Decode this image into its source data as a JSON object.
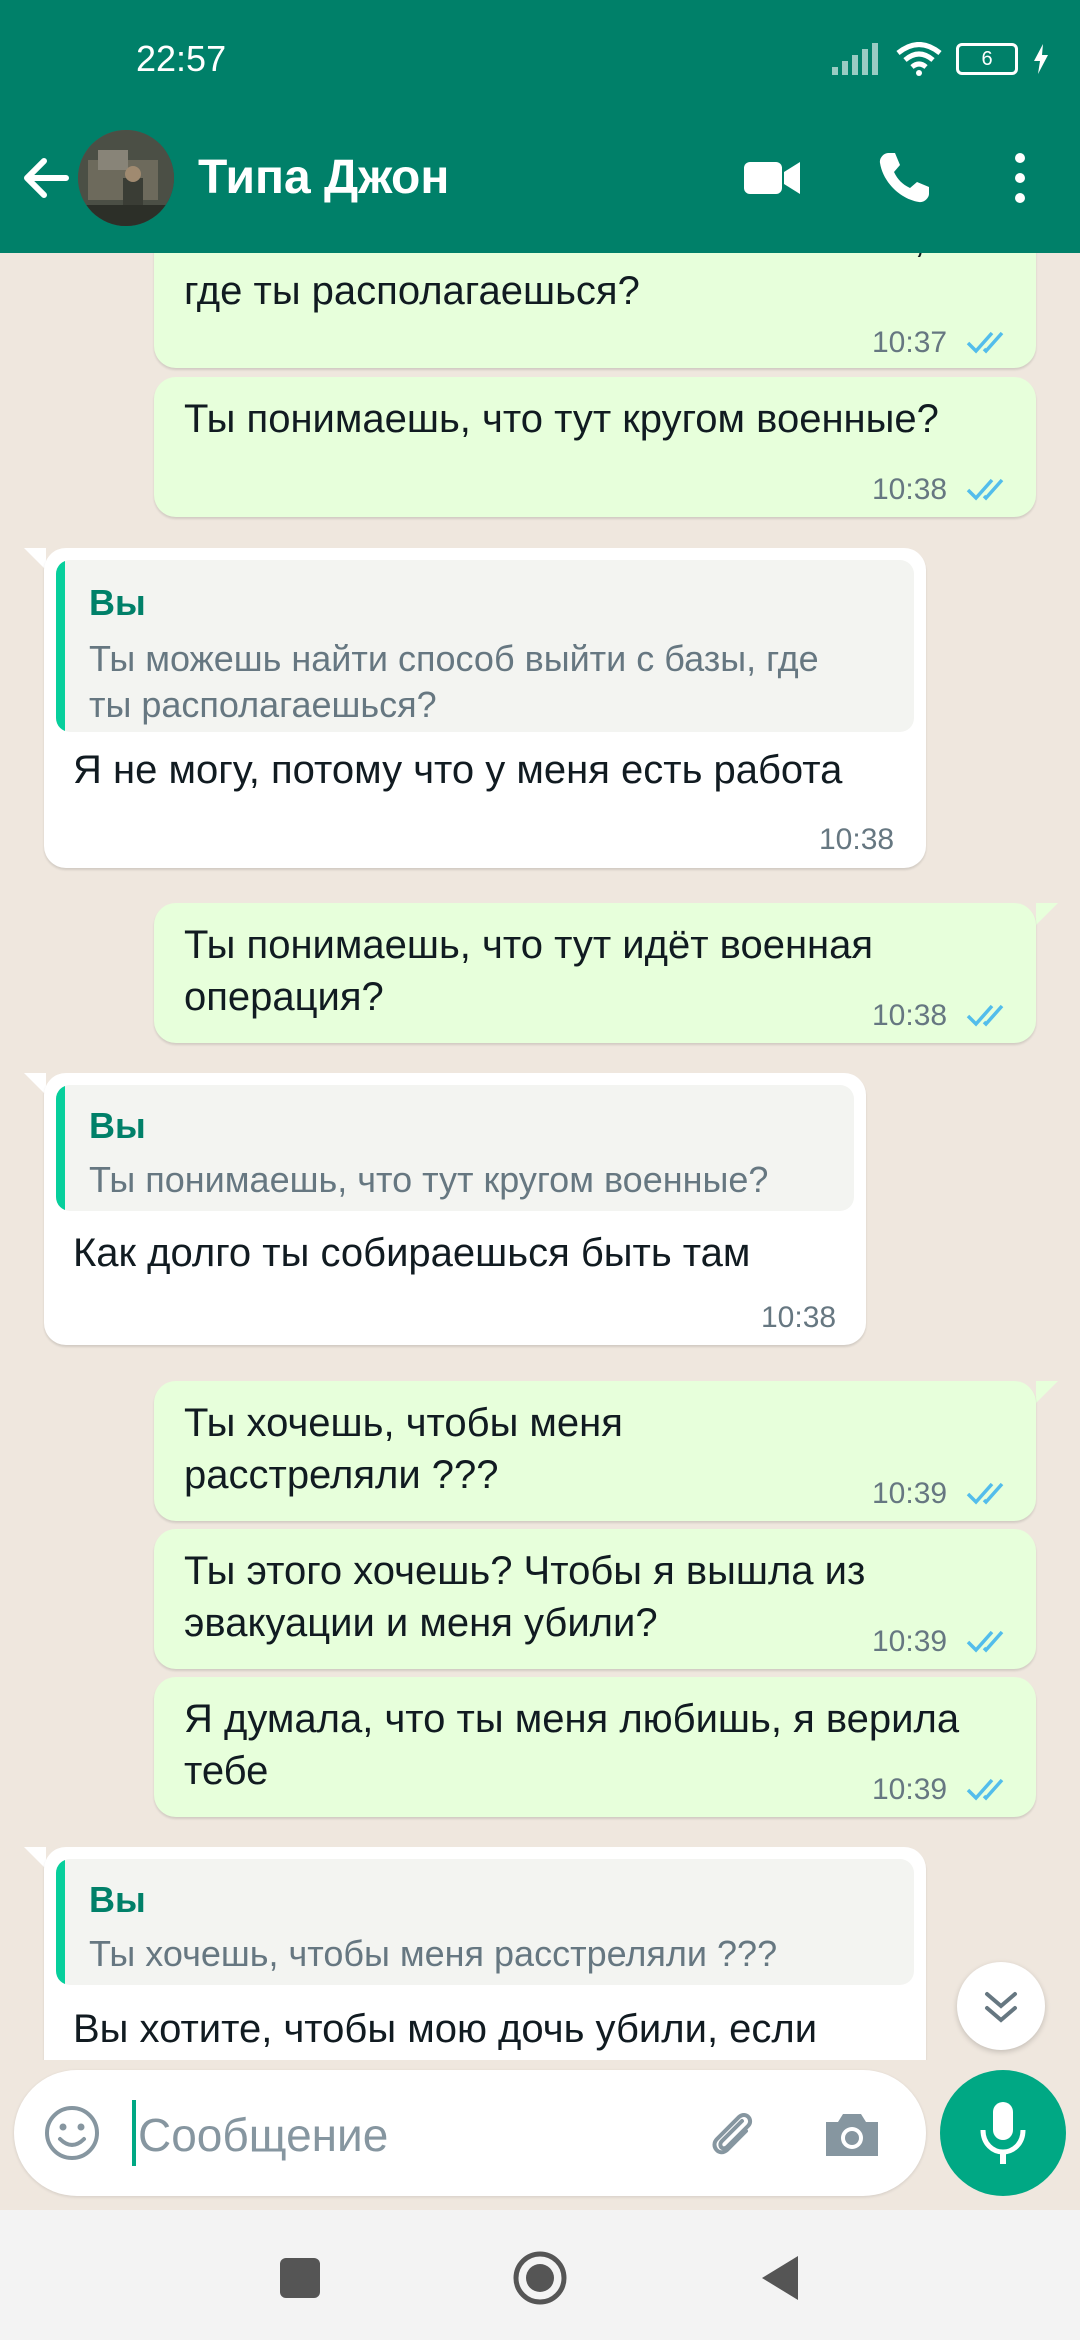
{
  "status_bar": {
    "time": "22:57",
    "battery": "6"
  },
  "header": {
    "contact_name": "Типа Джон"
  },
  "messages": [
    {
      "text": "Ты можешь найти способ выйти с базы, где ты располагаешься?",
      "time": "10:37"
    },
    {
      "text": "Ты понимаешь, что тут кругом военные?",
      "time": "10:38"
    },
    {
      "quote_author": "Вы",
      "quote_text": "Ты можешь найти способ выйти с базы, где ты располагаешься?",
      "text": "Я не могу, потому что у меня есть работа",
      "time": "10:38"
    },
    {
      "text": "Ты понимаешь, что тут идёт военная операция?",
      "time": "10:38"
    },
    {
      "quote_author": "Вы",
      "quote_text": "Ты понимаешь, что тут кругом военные?",
      "text": "Как долго ты собираешься быть там",
      "time": "10:38"
    },
    {
      "text": "Ты хочешь, чтобы меня расстреляли ???",
      "time": "10:39"
    },
    {
      "text": "Ты этого хочешь? Чтобы я вышла из эвакуации и меня убили?",
      "time": "10:39"
    },
    {
      "text": "Я думала, что ты меня любишь, я верила тебе",
      "time": "10:39"
    },
    {
      "quote_author": "Вы",
      "quote_text": "Ты хочешь, чтобы меня расстреляли ???",
      "text": "Вы хотите, чтобы мою дочь убили, если"
    }
  ],
  "input": {
    "placeholder": "Сообщение"
  },
  "colors": {
    "header": "#008069",
    "outgoing": "#E7FFDB",
    "incoming": "#FFFFFF",
    "read_ticks": "#53BDEB",
    "accent": "#00A884"
  }
}
